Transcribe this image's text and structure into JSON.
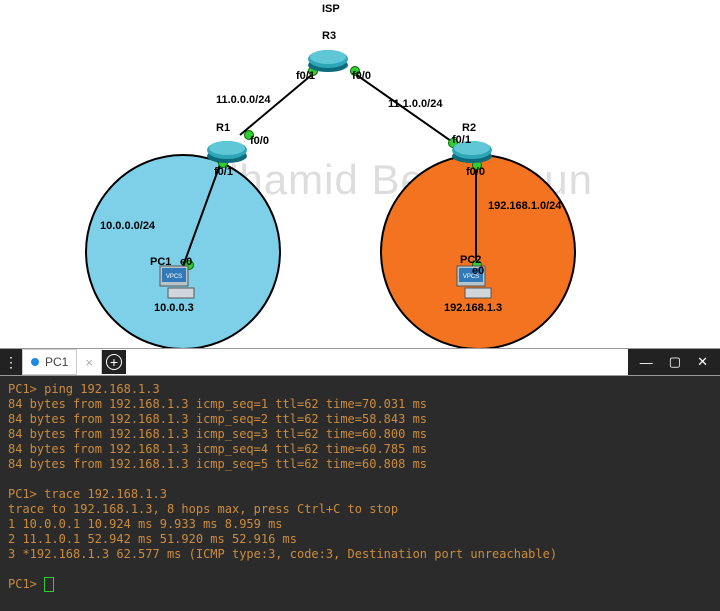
{
  "watermark": "Abdelhamid Bensadoun",
  "diagram": {
    "isp": "ISP",
    "r3": "R3",
    "r1": "R1",
    "r2": "R2",
    "pc1": "PC1",
    "pc2": "PC2",
    "pc1_if": "e0",
    "pc2_if": "e0",
    "vpcs": "VPCS",
    "r3_left_if": "f0/1",
    "r3_right_if": "f0/0",
    "r1_up_if": "f0/0",
    "r1_down_if": "f0/1",
    "r2_up_if": "f0/1",
    "r2_down_if": "f0/0",
    "left_link": "11.0.0.0/24",
    "right_link": "11.1.0.0/24",
    "left_lan": "10.0.0.0/24",
    "right_lan": "192.168.1.0/24",
    "pc1_ip": "10.0.0.3",
    "pc2_ip": "192.168.1.3"
  },
  "terminal": {
    "tab_title": "PC1",
    "lines": [
      "PC1> ping 192.168.1.3",
      "84 bytes from 192.168.1.3 icmp_seq=1 ttl=62 time=70.031 ms",
      "84 bytes from 192.168.1.3 icmp_seq=2 ttl=62 time=58.843 ms",
      "84 bytes from 192.168.1.3 icmp_seq=3 ttl=62 time=60.800 ms",
      "84 bytes from 192.168.1.3 icmp_seq=4 ttl=62 time=60.785 ms",
      "84 bytes from 192.168.1.3 icmp_seq=5 ttl=62 time=60.808 ms",
      "",
      "PC1> trace 192.168.1.3",
      "trace to 192.168.1.3, 8 hops max, press Ctrl+C to stop",
      " 1   10.0.0.1   10.924 ms  9.933 ms  8.959 ms",
      " 2   11.1.0.1   52.942 ms  51.920 ms  52.916 ms",
      " 3   *192.168.1.3   62.577 ms (ICMP type:3, code:3, Destination port unreachable)",
      ""
    ],
    "final_prompt": "PC1> "
  }
}
